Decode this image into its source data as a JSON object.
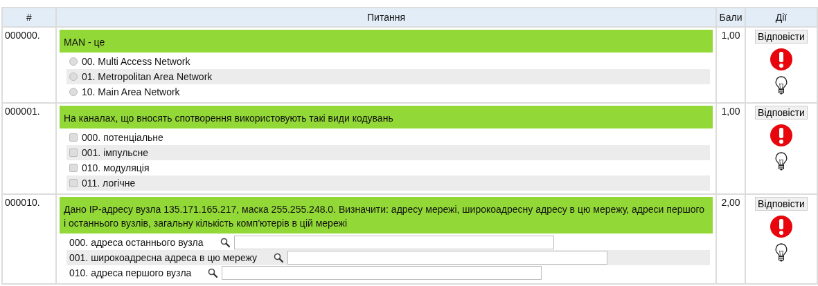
{
  "table": {
    "columns": [
      "#",
      "Питання",
      "Бали",
      "Дії"
    ],
    "rows": [
      {
        "number": "000000.",
        "question": "MAN - це",
        "kind": "radio",
        "points": "1,00",
        "answer_button": "Відповісти",
        "options": [
          {
            "label": "00. Multi Access Network",
            "checked": false
          },
          {
            "label": "01. Metropolitan Area Network",
            "checked": false
          },
          {
            "label": "10. Main Area Network",
            "checked": false
          }
        ]
      },
      {
        "number": "000001.",
        "question": "На каналах, що вносять спотворення використовують такі види кодувань",
        "kind": "checkbox",
        "points": "1,00",
        "answer_button": "Відповісти",
        "options": [
          {
            "label": "000. потенціальне",
            "checked": false
          },
          {
            "label": "001. імпульсне",
            "checked": false
          },
          {
            "label": "010. модуляція",
            "checked": false
          },
          {
            "label": "011. логічне",
            "checked": false
          }
        ]
      },
      {
        "number": "000010.",
        "question": "Дано IP-адресу вузла 135.171.165.217, маска 255.255.248.0. Визначити: адресу мережі, широкоадресну адресу в цю мережу, адреси першого і останнього вузлів, загальну кількість комп'ютерів в цій мережі",
        "kind": "text",
        "points": "2,00",
        "answer_button": "Відповісти",
        "options": [
          {
            "label": "000. адреса останнього вузла"
          },
          {
            "label": "001. широкоадресна адреса в цю мережу"
          },
          {
            "label": "010. адреса першого вузла"
          }
        ]
      }
    ]
  }
}
